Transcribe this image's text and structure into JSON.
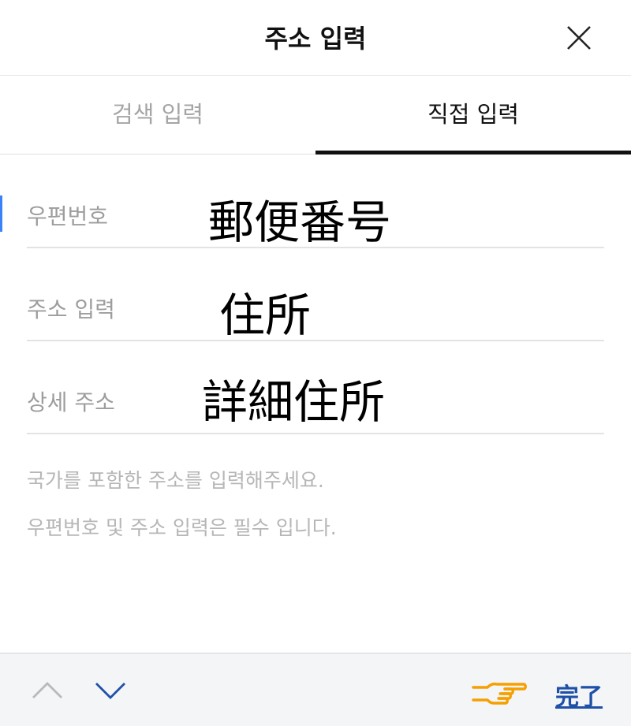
{
  "header": {
    "title": "주소 입력",
    "close_icon": "close-icon"
  },
  "tabs": [
    {
      "label": "검색 입력",
      "active": false
    },
    {
      "label": "직접 입력",
      "active": true
    }
  ],
  "fields": [
    {
      "label": "우편번호",
      "overlay_text": "郵便番号"
    },
    {
      "label": "주소 입력",
      "overlay_text": "住所"
    },
    {
      "label": "상세 주소",
      "overlay_text": "詳細住所"
    }
  ],
  "hints": [
    "국가를 포함한 주소를 입력해주세요.",
    "우편번호 및 주소 입력은 필수 입니다."
  ],
  "toolbar": {
    "prev_icon": "chevron-up-icon",
    "next_icon": "chevron-down-icon",
    "pointer_icon": "pointing-hand-icon",
    "done_label": "完了"
  },
  "colors": {
    "caret": "#3b82f6",
    "done": "#1f50a8",
    "next_chevron": "#1f50a8",
    "hand": "#f5a000"
  }
}
